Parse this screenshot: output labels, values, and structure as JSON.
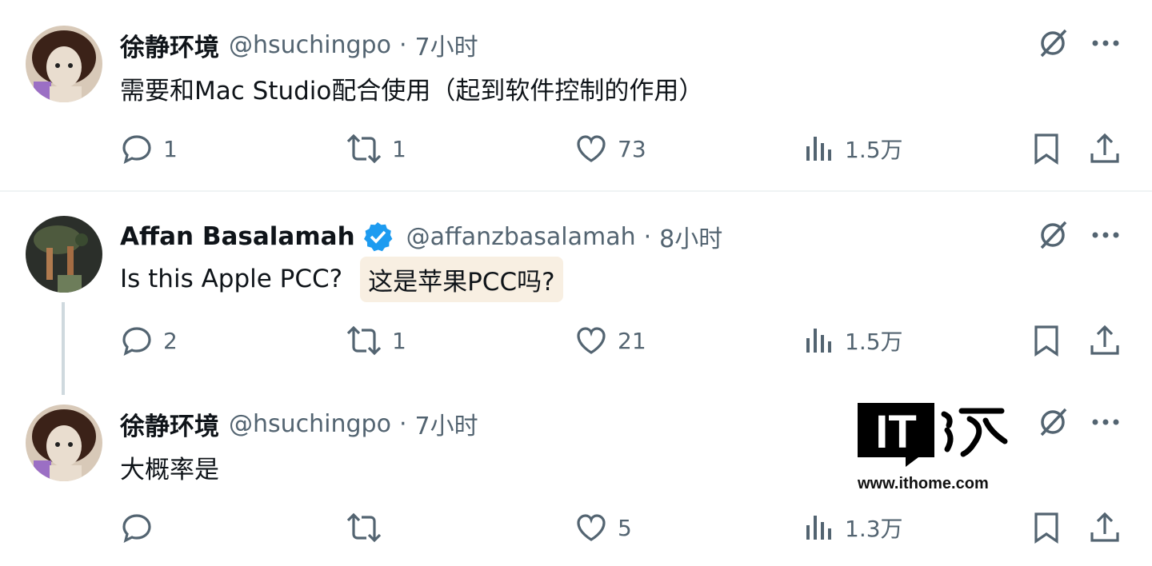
{
  "tweets": [
    {
      "name": "徐静环境",
      "handle": "@hsuchingpo",
      "separator": "·",
      "time": "7小时",
      "text": "需要和Mac Studio配合使用（起到软件控制的作用）",
      "replies": "1",
      "retweets": "1",
      "likes": "73",
      "views": "1.5万"
    },
    {
      "name": "Affan Basalamah",
      "verified": true,
      "handle": "@affanzbasalamah",
      "separator": "·",
      "time": "8小时",
      "text": "Is this Apple PCC?",
      "translation": "这是苹果PCC吗?",
      "replies": "2",
      "retweets": "1",
      "likes": "21",
      "views": "1.5万"
    },
    {
      "name": "徐静环境",
      "handle": "@hsuchingpo",
      "separator": "·",
      "time": "7小时",
      "text": "大概率是",
      "replies": "",
      "retweets": "",
      "likes": "5",
      "views": "1.3万"
    }
  ],
  "watermark": {
    "logo_text": "IT",
    "url": "www.ithome.com"
  },
  "colors": {
    "text_primary": "#0f1419",
    "text_secondary": "#536471",
    "verified_blue": "#1d9bf0",
    "translation_bg": "#f8efe2"
  },
  "icons": [
    "avatar",
    "verified-badge-icon",
    "grok-icon",
    "more-icon",
    "reply-icon",
    "retweet-icon",
    "like-icon",
    "views-icon",
    "bookmark-icon",
    "share-icon"
  ]
}
